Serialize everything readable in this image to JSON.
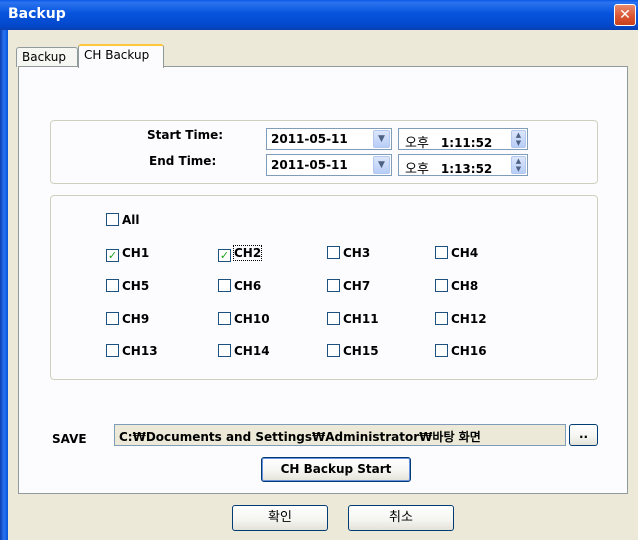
{
  "window": {
    "title": "Backup",
    "close_glyph": "✕"
  },
  "tabs": [
    {
      "label": "Backup",
      "selected": false
    },
    {
      "label": "CH Backup",
      "selected": true
    }
  ],
  "time": {
    "start_label": "Start Time:",
    "end_label": "End Time:",
    "start_date": "2011-05-11",
    "end_date": "2011-05-11",
    "start_ampm": "오후",
    "start_clock": "1:11:52",
    "end_ampm": "오후",
    "end_clock": "1:13:52"
  },
  "channels": {
    "all": {
      "label": "All",
      "checked": false
    },
    "items": [
      {
        "label": "CH1",
        "checked": true
      },
      {
        "label": "CH2",
        "checked": true
      },
      {
        "label": "CH3",
        "checked": false
      },
      {
        "label": "CH4",
        "checked": false
      },
      {
        "label": "CH5",
        "checked": false
      },
      {
        "label": "CH6",
        "checked": false
      },
      {
        "label": "CH7",
        "checked": false
      },
      {
        "label": "CH8",
        "checked": false
      },
      {
        "label": "CH9",
        "checked": false
      },
      {
        "label": "CH10",
        "checked": false
      },
      {
        "label": "CH11",
        "checked": false
      },
      {
        "label": "CH12",
        "checked": false
      },
      {
        "label": "CH13",
        "checked": false
      },
      {
        "label": "CH14",
        "checked": false
      },
      {
        "label": "CH15",
        "checked": false
      },
      {
        "label": "CH16",
        "checked": false
      }
    ]
  },
  "save": {
    "label": "SAVE",
    "path": "C:₩Documents and Settings₩Administrator₩바탕 화면",
    "browse_label": ".."
  },
  "start_button": "CH Backup Start",
  "dialog_buttons": {
    "ok": "확인",
    "cancel": "취소"
  },
  "icons": {
    "check": "✓",
    "dropdown": "chevron-down-icon",
    "spin": "spin-updown-icon"
  }
}
